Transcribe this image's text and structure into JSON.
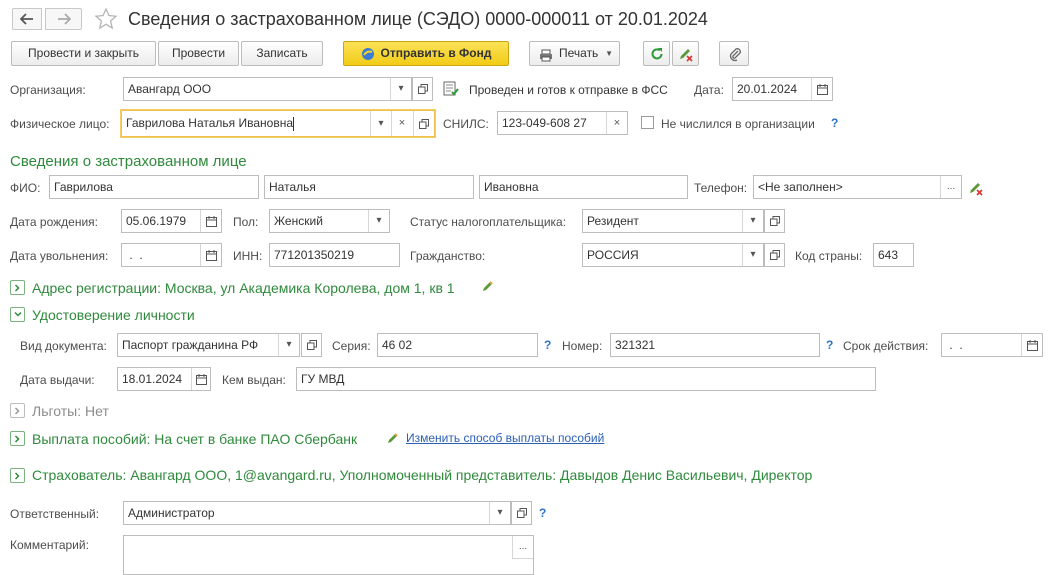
{
  "title": "Сведения о застрахованном лице (СЭДО) 0000-000011 от 20.01.2024",
  "toolbar": {
    "post_close": "Провести и закрыть",
    "post": "Провести",
    "save": "Записать",
    "send_fund": "Отправить в Фонд",
    "print": "Печать"
  },
  "header": {
    "org_label": "Организация:",
    "org_value": "Авангард ООО",
    "status_text": "Проведен и готов к отправке в ФСС",
    "date_label": "Дата:",
    "date_value": "20.01.2024",
    "person_label": "Физическое лицо:",
    "person_value": "Гаврилова Наталья Ивановна",
    "snils_label": "СНИЛС:",
    "snils_value": "123-049-608 27",
    "not_in_org_label": "Не числился в организации",
    "help": "?"
  },
  "insured": {
    "section_title": "Сведения о застрахованном лице",
    "fio_label": "ФИО:",
    "last_name": "Гаврилова",
    "first_name": "Наталья",
    "middle_name": "Ивановна",
    "phone_label": "Телефон:",
    "phone_value": "<Не заполнен>",
    "birth_label": "Дата рождения:",
    "birth_value": "05.06.1979",
    "sex_label": "Пол:",
    "sex_value": "Женский",
    "tax_status_label": "Статус налогоплательщика:",
    "tax_status_value": "Резидент",
    "dismiss_label": "Дата увольнения:",
    "dismiss_value": " .  .",
    "inn_label": "ИНН:",
    "inn_value": "771201350219",
    "citizenship_label": "Гражданство:",
    "citizenship_value": "РОССИЯ",
    "country_code_label": "Код страны:",
    "country_code_value": "643"
  },
  "address_section": "Адрес регистрации: Москва, ул Академика Королева, дом 1, кв 1",
  "identity": {
    "section_title": "Удостоверение личности",
    "doc_type_label": "Вид документа:",
    "doc_type_value": "Паспорт гражданина РФ",
    "series_label": "Серия:",
    "series_value": "46 02",
    "number_label": "Номер:",
    "number_value": "321321",
    "validity_label": "Срок действия:",
    "validity_value": " .  .",
    "issue_date_label": "Дата выдачи:",
    "issue_date_value": "18.01.2024",
    "issued_by_label": "Кем выдан:",
    "issued_by_value": "ГУ МВД"
  },
  "benefits_section": "Льготы: Нет",
  "payment_section": "Выплата пособий: На счет в банке ПАО Сбербанк",
  "payment_link": "Изменить способ выплаты пособий",
  "insurer_section": "Страхователь: Авангард ООО, 1@avangard.ru, Уполномоченный представитель: Давыдов Денис Васильевич, Директор",
  "footer": {
    "responsible_label": "Ответственный:",
    "responsible_value": "Администратор",
    "comment_label": "Комментарий:",
    "comment_value": ""
  },
  "colors": {
    "section_green": "#2f8a3c",
    "link_blue": "#2b74c7",
    "send_yellow": "#f5d327",
    "focus_yellow": "#f2c14b"
  }
}
